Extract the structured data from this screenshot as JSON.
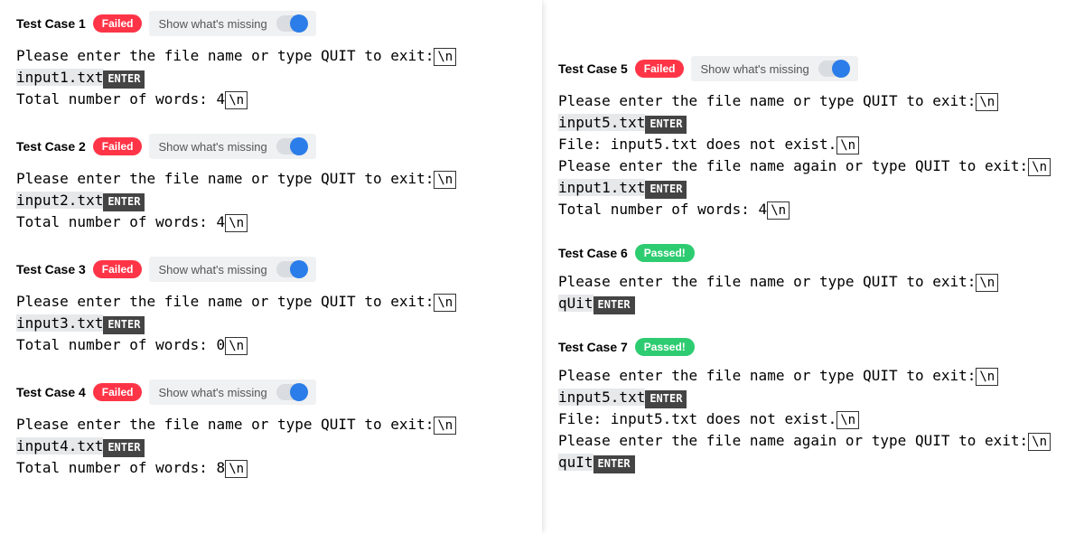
{
  "labels": {
    "show_missing": "Show what's missing",
    "status_failed": "Failed",
    "status_passed": "Passed!",
    "newline_sym": "\\n",
    "enter_sym": "ENTER"
  },
  "testcases": [
    {
      "title": "Test Case 1",
      "status": "failed",
      "toggle": true,
      "lines": [
        [
          {
            "t": "Please enter the file name or type QUIT to exit:"
          },
          {
            "sym": "nl"
          }
        ],
        [
          {
            "t": "input1.txt",
            "hl": true
          },
          {
            "sym": "enter"
          }
        ],
        [
          {
            "t": "Total number of words: 4"
          },
          {
            "sym": "nl"
          }
        ]
      ]
    },
    {
      "title": "Test Case 2",
      "status": "failed",
      "toggle": true,
      "lines": [
        [
          {
            "t": "Please enter the file name or type QUIT to exit:"
          },
          {
            "sym": "nl"
          }
        ],
        [
          {
            "t": "input2.txt",
            "hl": true
          },
          {
            "sym": "enter"
          }
        ],
        [
          {
            "t": "Total number of words: 4"
          },
          {
            "sym": "nl"
          }
        ]
      ]
    },
    {
      "title": "Test Case 3",
      "status": "failed",
      "toggle": true,
      "lines": [
        [
          {
            "t": "Please enter the file name or type QUIT to exit:"
          },
          {
            "sym": "nl"
          }
        ],
        [
          {
            "t": "input3.txt",
            "hl": true
          },
          {
            "sym": "enter"
          }
        ],
        [
          {
            "t": "Total number of words: 0"
          },
          {
            "sym": "nl"
          }
        ]
      ]
    },
    {
      "title": "Test Case 4",
      "status": "failed",
      "toggle": true,
      "lines": [
        [
          {
            "t": "Please enter the file name or type QUIT to exit:"
          },
          {
            "sym": "nl"
          }
        ],
        [
          {
            "t": "input4.txt",
            "hl": true
          },
          {
            "sym": "enter"
          }
        ],
        [
          {
            "t": "Total number of words: 8"
          },
          {
            "sym": "nl"
          }
        ]
      ]
    },
    {
      "title": "Test Case 5",
      "status": "failed",
      "toggle": true,
      "lines": [
        [
          {
            "t": "Please enter the file name or type QUIT to exit:"
          },
          {
            "sym": "nl"
          }
        ],
        [
          {
            "t": "input5.txt",
            "hl": true
          },
          {
            "sym": "enter"
          }
        ],
        [
          {
            "t": "File: input5.txt does not exist."
          },
          {
            "sym": "nl"
          }
        ],
        [
          {
            "t": "Please enter the file name again or type QUIT to exit:"
          },
          {
            "sym": "nl"
          }
        ],
        [
          {
            "t": "input1.txt",
            "hl": true
          },
          {
            "sym": "enter"
          }
        ],
        [
          {
            "t": "Total number of words: 4"
          },
          {
            "sym": "nl"
          }
        ]
      ]
    },
    {
      "title": "Test Case 6",
      "status": "passed",
      "toggle": false,
      "lines": [
        [
          {
            "t": "Please enter the file name or type QUIT to exit:"
          },
          {
            "sym": "nl"
          }
        ],
        [
          {
            "t": "qUit",
            "hl": true
          },
          {
            "sym": "enter"
          }
        ]
      ]
    },
    {
      "title": "Test Case 7",
      "status": "passed",
      "toggle": false,
      "lines": [
        [
          {
            "t": "Please enter the file name or type QUIT to exit:"
          },
          {
            "sym": "nl"
          }
        ],
        [
          {
            "t": "input5.txt",
            "hl": true
          },
          {
            "sym": "enter"
          }
        ],
        [
          {
            "t": "File: input5.txt does not exist."
          },
          {
            "sym": "nl"
          }
        ],
        [
          {
            "t": "Please enter the file name again or type QUIT to exit:"
          },
          {
            "sym": "nl"
          }
        ],
        [
          {
            "t": "quIt",
            "hl": true
          },
          {
            "sym": "enter"
          }
        ]
      ]
    }
  ]
}
